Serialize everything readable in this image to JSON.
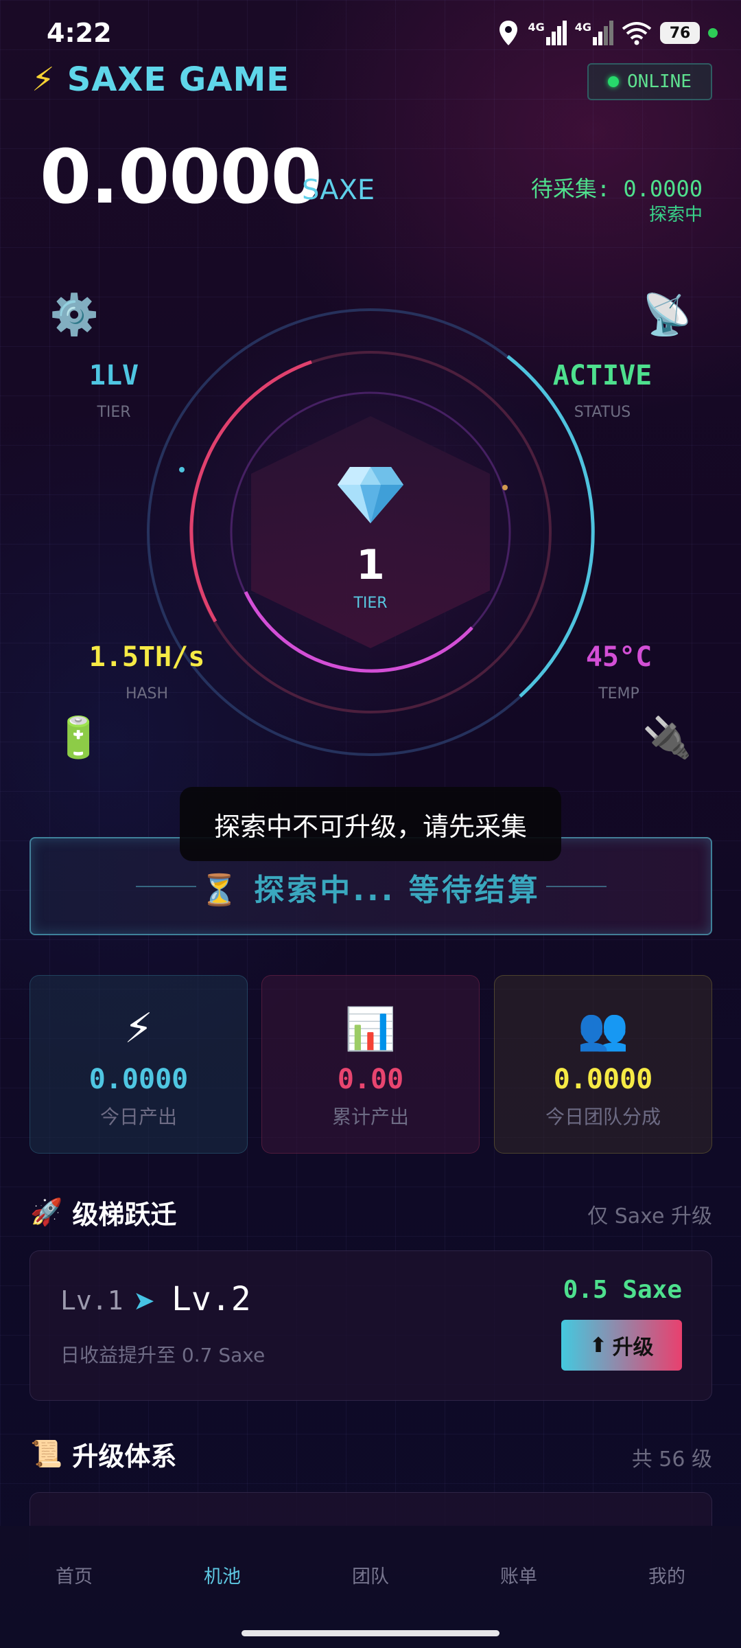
{
  "status_bar": {
    "time": "4:22",
    "network_1": "4G",
    "network_2": "4G",
    "battery": "76"
  },
  "header": {
    "app_title": "SAXE GAME",
    "online_label": "ONLINE"
  },
  "balance": {
    "amount": "0.0000",
    "unit": "SAXE",
    "pending": "待采集: 0.0000",
    "state": "探索中"
  },
  "miner": {
    "tier_value": "1LV",
    "tier_label": "TIER",
    "status_value": "ACTIVE",
    "status_label": "STATUS",
    "hash_value": "1.5TH/s",
    "hash_label": "HASH",
    "temp_value": "45°C",
    "temp_label": "TEMP",
    "center_number": "1",
    "center_label": "TIER",
    "icons": [
      "gear-icon",
      "satellite-icon",
      "battery-icon",
      "plug-icon",
      "diamond-icon"
    ]
  },
  "toast": "探索中不可升级，请先采集",
  "explore_banner": "⏳ 探索中... 等待结算",
  "stats": [
    {
      "icon": "⚡",
      "value": "0.0000",
      "label": "今日产出",
      "color": "#4fc6e2"
    },
    {
      "icon": "📊",
      "value": "0.00",
      "label": "累计产出",
      "color": "#e8456f"
    },
    {
      "icon": "👥",
      "value": "0.0000",
      "label": "今日团队分成",
      "color": "#f6ea45"
    }
  ],
  "upgrade_section": {
    "title": "级梯跃迁",
    "hint": "仅 Saxe 升级",
    "from_level": "Lv.1",
    "to_level": "Lv.2",
    "description": "日收益提升至 0.7 Saxe",
    "price": "0.5 Saxe",
    "button_label": "升级"
  },
  "system_section": {
    "title": "升级体系",
    "count": "共 56 级"
  },
  "bottom_nav": [
    "首页",
    "机池",
    "团队",
    "账单",
    "我的"
  ],
  "bottom_nav_active": "机池",
  "colors": {
    "accent_cyan": "#5fd6ea",
    "accent_pink": "#e8456f",
    "accent_green": "#4ee08e",
    "accent_yellow": "#f6ea45",
    "accent_magenta": "#d34fd6"
  }
}
